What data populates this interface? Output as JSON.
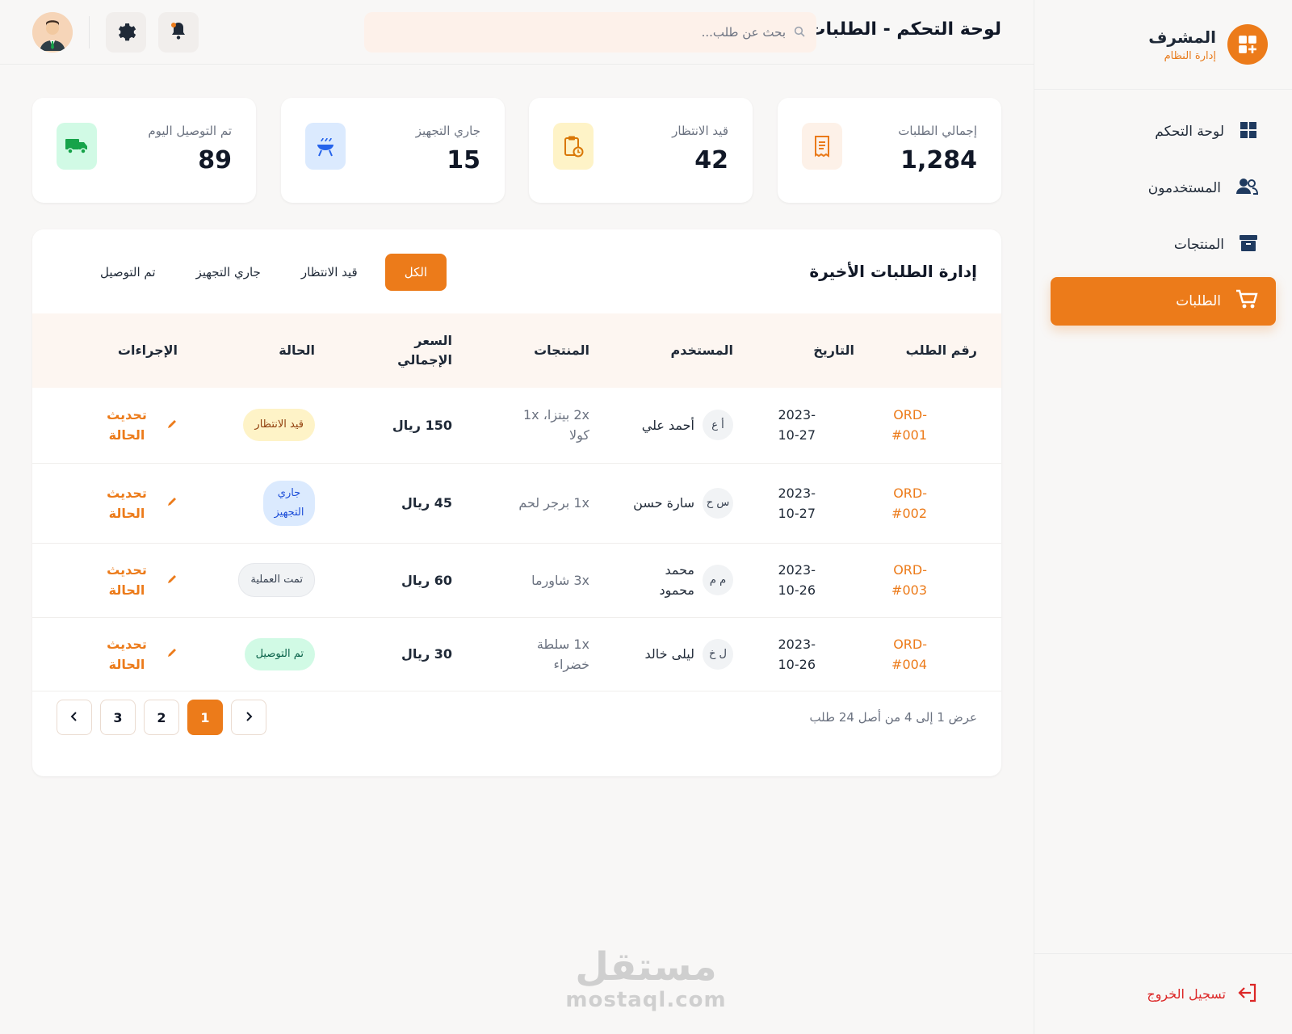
{
  "brand": {
    "title": "المشرف",
    "subtitle": "إدارة النظام",
    "logo_icon": "dashboard-add-icon"
  },
  "sidebar": {
    "items": [
      {
        "label": "لوحة التحكم",
        "icon": "grid-icon",
        "active": false
      },
      {
        "label": "المستخدمون",
        "icon": "users-icon",
        "active": false
      },
      {
        "label": "المنتجات",
        "icon": "archive-icon",
        "active": false
      },
      {
        "label": "الطلبات",
        "icon": "cart-icon",
        "active": true
      }
    ],
    "logout_label": "تسجيل الخروج"
  },
  "header": {
    "title": "لوحة التحكم - الطلبات",
    "search_placeholder": "بحث عن طلب..."
  },
  "stats": [
    {
      "label": "إجمالي الطلبات",
      "value": "1,284",
      "icon": "receipt-icon",
      "color": "#ea7a1a",
      "bg": "#fdf1e8"
    },
    {
      "label": "قيد الانتظار",
      "value": "42",
      "icon": "pending-clipboard-icon",
      "color": "#d97706",
      "bg": "#fef3c7"
    },
    {
      "label": "جاري التجهيز",
      "value": "15",
      "icon": "cooking-icon",
      "color": "#2563eb",
      "bg": "#dbeafe"
    },
    {
      "label": "تم التوصيل اليوم",
      "value": "89",
      "icon": "truck-icon",
      "color": "#16a34a",
      "bg": "#d1fae5"
    }
  ],
  "orders": {
    "title": "إدارة الطلبات الأخيرة",
    "filters": [
      "الكل",
      "قيد الانتظار",
      "جاري التجهيز",
      "تم التوصيل"
    ],
    "active_filter": "الكل",
    "columns": [
      "رقم الطلب",
      "التاريخ",
      "المستخدم",
      "المنتجات",
      "السعر الإجمالي",
      "الحالة",
      "الإجراءات"
    ],
    "rows": [
      {
        "id": "ORD-#001",
        "date": "2023-10-27",
        "initials": "أ ع",
        "user": "أحمد علي",
        "products": "2x بيتزا، 1x كولا",
        "price": "150 ريال",
        "status": "قيد الانتظار",
        "status_type": "pending",
        "action": "تحديث الحالة"
      },
      {
        "id": "ORD-#002",
        "date": "2023-10-27",
        "initials": "س ح",
        "user": "سارة حسن",
        "products": "1x برجر لحم",
        "price": "45 ريال",
        "status": "جاري التجهيز",
        "status_type": "prep",
        "action": "تحديث الحالة"
      },
      {
        "id": "ORD-#003",
        "date": "2023-10-26",
        "initials": "م م",
        "user": "محمد محمود",
        "products": "3x شاورما",
        "price": "60 ريال",
        "status": "تمت العملية",
        "status_type": "done",
        "action": "تحديث الحالة"
      },
      {
        "id": "ORD-#004",
        "date": "2023-10-26",
        "initials": "ل خ",
        "user": "ليلى خالد",
        "products": "1x سلطة خضراء",
        "price": "30 ريال",
        "status": "تم التوصيل",
        "status_type": "delivered",
        "action": "تحديث الحالة"
      }
    ],
    "summary": "عرض 1 إلى 4 من أصل 24 طلب",
    "pages": [
      "1",
      "2",
      "3"
    ],
    "current_page": "1"
  },
  "watermark": {
    "arabic": "مستقل",
    "latin": "mostaql.com"
  }
}
